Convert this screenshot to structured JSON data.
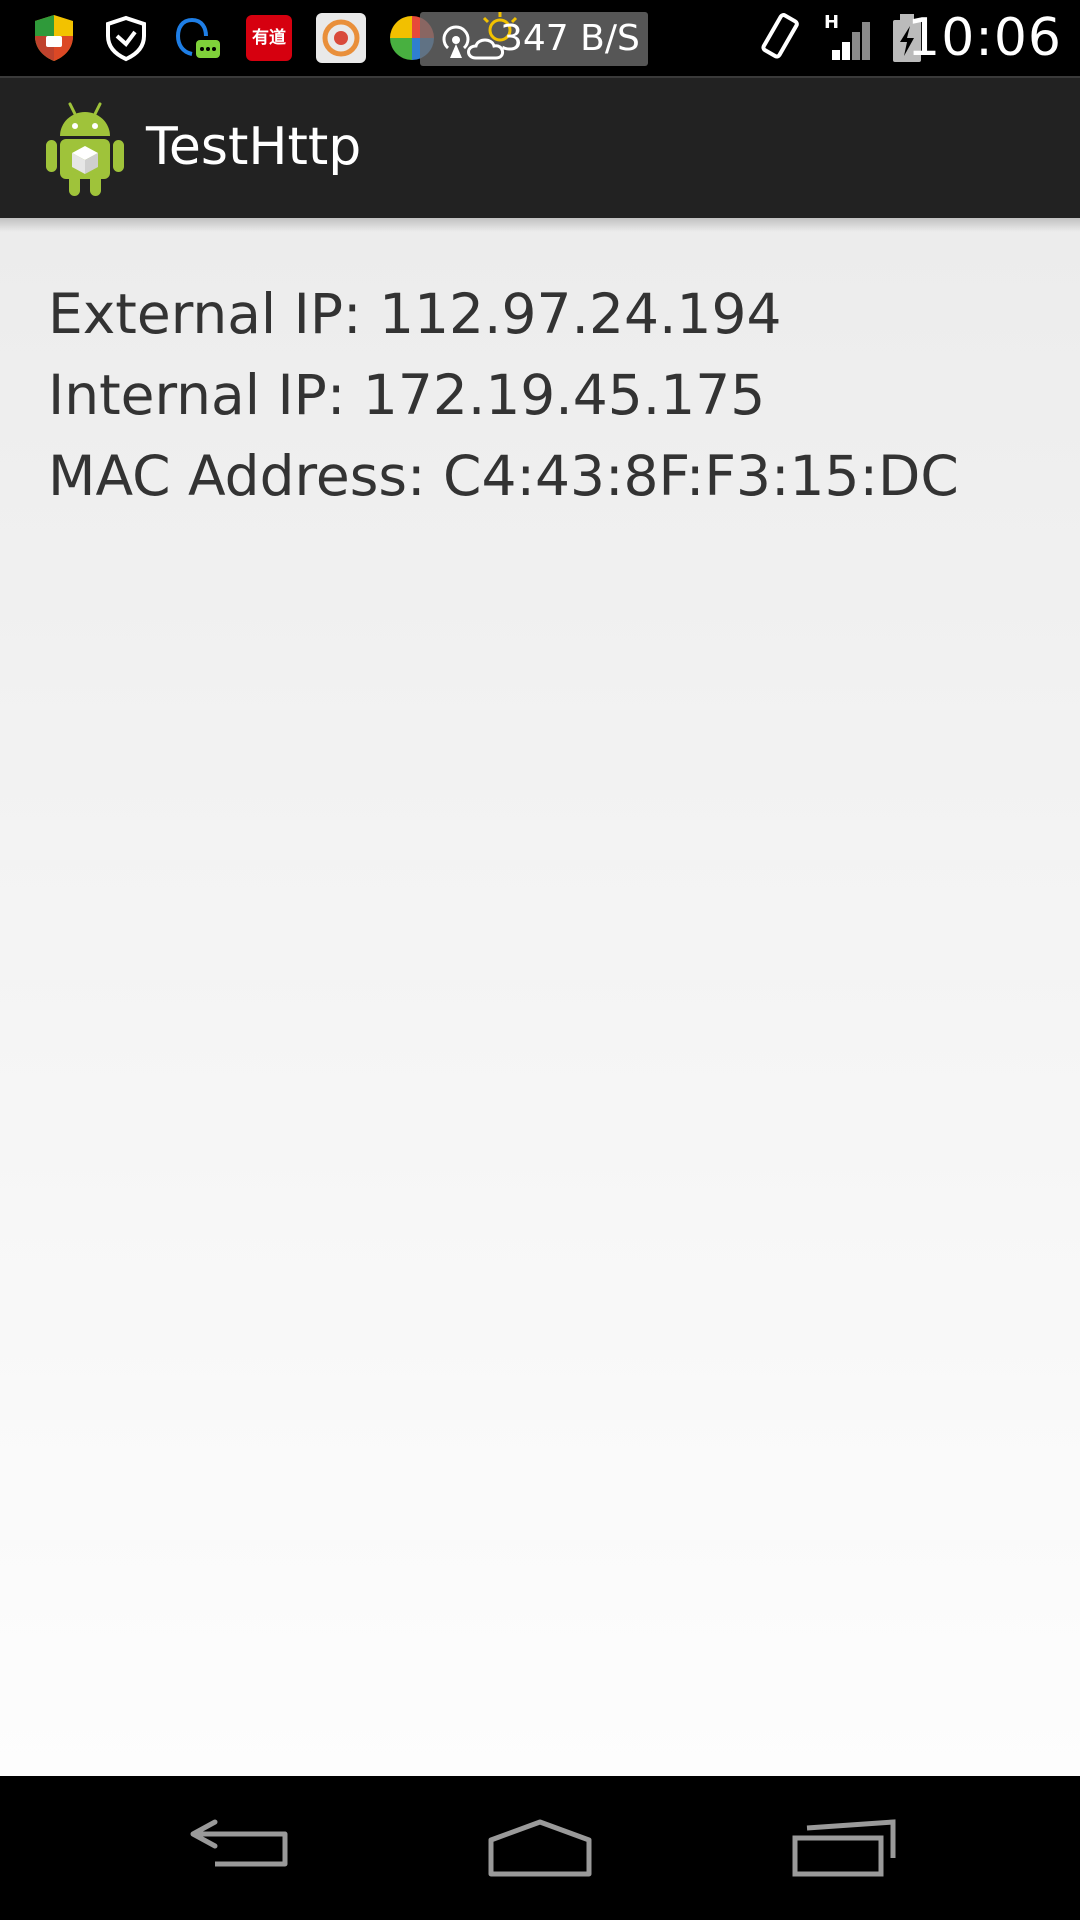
{
  "status_bar": {
    "notification_icons": [
      "shield-icon",
      "vpn-shield-icon",
      "qq-chat-icon",
      "youdao-icon",
      "app-badge-icon",
      "color-wheel-icon",
      "hotspot-icon",
      "weather-icon"
    ],
    "net_speed": "347 B/S",
    "network_type": "H",
    "time": "10:06"
  },
  "action_bar": {
    "title": "TestHttp",
    "icon": "android-robot-icon"
  },
  "info": {
    "external_ip": "External IP: 112.97.24.194",
    "internal_ip": "Internal IP: 172.19.45.175",
    "mac_address": "MAC Address: C4:43:8F:F3:15:DC"
  },
  "nav_bar": {
    "buttons": [
      "back-icon",
      "home-icon",
      "recents-icon"
    ]
  },
  "colors": {
    "action_bar_bg": "#222222",
    "content_text": "#333333",
    "android_green": "#9fc33a"
  }
}
